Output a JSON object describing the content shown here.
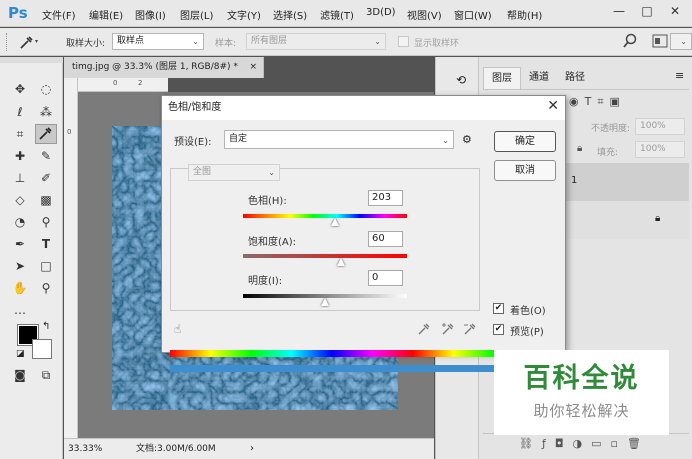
{
  "app": {
    "logo": "Ps"
  },
  "menu": [
    "文件(F)",
    "编辑(E)",
    "图像(I)",
    "图层(L)",
    "文字(Y)",
    "选择(S)",
    "滤镜(T)",
    "3D(D)",
    "视图(V)",
    "窗口(W)",
    "帮助(H)"
  ],
  "window_controls": {
    "minimize": "—",
    "restore": "□",
    "close": "✕"
  },
  "options": {
    "sample_size_label": "取样大小:",
    "sample_size_value": "取样点",
    "sample_label": "样本:",
    "sample_value": "所有图层",
    "show_ring": "显示取样环"
  },
  "document": {
    "tab_title": "timg.jpg @ 33.3% (图层 1, RGB/8#) *",
    "tab_close": "×",
    "zoom": "33.33%",
    "doc_info": "文档:3.00M/6.00M",
    "ruler_h": [
      "0",
      "2"
    ],
    "ruler_v": [
      "0"
    ]
  },
  "right_panel": {
    "tabs": [
      "图层",
      "通道",
      "路径"
    ],
    "opacity_label": "不透明度:",
    "opacity_value": "100%",
    "fill_label": "填充:",
    "fill_value": "100%",
    "layer1_label": "1"
  },
  "dialog": {
    "title": "色相/饱和度",
    "close": "✕",
    "preset_label": "预设(E):",
    "preset_value": "自定",
    "channel_value": "全图",
    "hue_label": "色相(H):",
    "hue_value": "203",
    "hue_position": 0.56,
    "saturation_label": "饱和度(A):",
    "saturation_value": "60",
    "saturation_position": 0.6,
    "lightness_label": "明度(I):",
    "lightness_value": "0",
    "lightness_position": 0.5,
    "ok_button": "确定",
    "cancel_button": "取消",
    "colorize_label": "着色(O)",
    "colorize_checked": true,
    "preview_label": "预览(P)",
    "preview_checked": true
  },
  "watermark": {
    "title": "百科全说",
    "subtitle": "助你轻松解决"
  }
}
